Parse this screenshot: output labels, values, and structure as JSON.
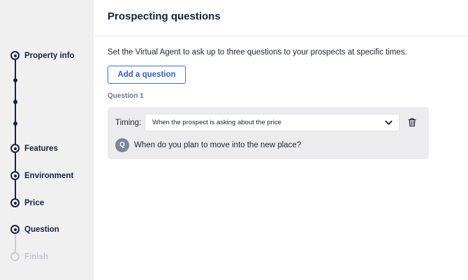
{
  "page": {
    "title": "Prospecting questions"
  },
  "stepper": {
    "steps": [
      {
        "label": "Property info",
        "state": "done"
      },
      {
        "label": "Features",
        "state": "done"
      },
      {
        "label": "Environment",
        "state": "done"
      },
      {
        "label": "Price",
        "state": "done"
      },
      {
        "label": "Question",
        "state": "current"
      },
      {
        "label": "Finish",
        "state": "upcoming"
      }
    ]
  },
  "main": {
    "intro": "Set the Virtual Agent to ask up to three questions to your prospects at specific times.",
    "add_button_label": "Add a question",
    "questions": [
      {
        "heading": "Question 1",
        "timing_label": "Timing:",
        "timing_value": "When the prospect is asking about the price",
        "badge": "Q",
        "text": "When do you plan to move into the new place?"
      }
    ]
  },
  "icons": {
    "dropdown": "chevron-down-icon",
    "delete": "trash-icon"
  },
  "colors": {
    "sidebar_bg": "#f0f0f1",
    "stepper_active": "#16223d",
    "stepper_inactive": "#c9cbd0",
    "accent": "#2d63d0",
    "card_bg": "#ececee"
  }
}
